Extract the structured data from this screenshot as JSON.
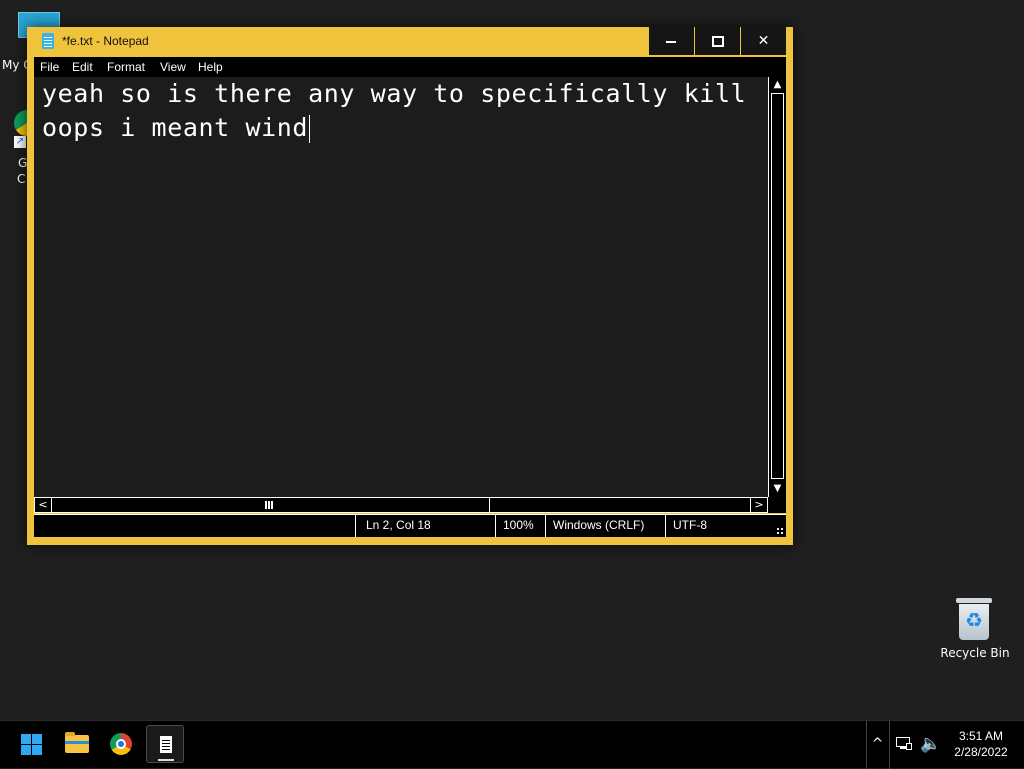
{
  "desktop": {
    "icons": [
      {
        "name": "My Computer",
        "label": "My C"
      },
      {
        "name": "Google Chrome",
        "label_line1": "G",
        "label_line2": "C"
      },
      {
        "name": "Recycle Bin",
        "label": "Recycle Bin"
      }
    ]
  },
  "window": {
    "title": "*fe.txt - Notepad",
    "buttons": {
      "minimize": "",
      "maximize": "",
      "close": "✕"
    },
    "menu": [
      "File",
      "Edit",
      "Format",
      "View",
      "Help"
    ],
    "editor": {
      "lines": [
        "yeah so is there any way to specifically kill",
        "oops i meant wind"
      ]
    },
    "scrollbars": {
      "up": "▲",
      "down": "▼",
      "left": "<",
      "right": ">"
    },
    "status": {
      "position": "Ln 2, Col 18",
      "zoom": "100%",
      "line_ending": "Windows (CRLF)",
      "encoding": "UTF-8"
    },
    "accent_color": "#f0c33c"
  },
  "taskbar": {
    "apps": [
      "start-icon",
      "file-explorer-icon",
      "chrome-icon",
      "notepad-icon"
    ],
    "tray": {
      "chevron": "^",
      "volume": "🔈"
    },
    "clock": {
      "time": "3:51 AM",
      "date": "2/28/2022"
    }
  }
}
